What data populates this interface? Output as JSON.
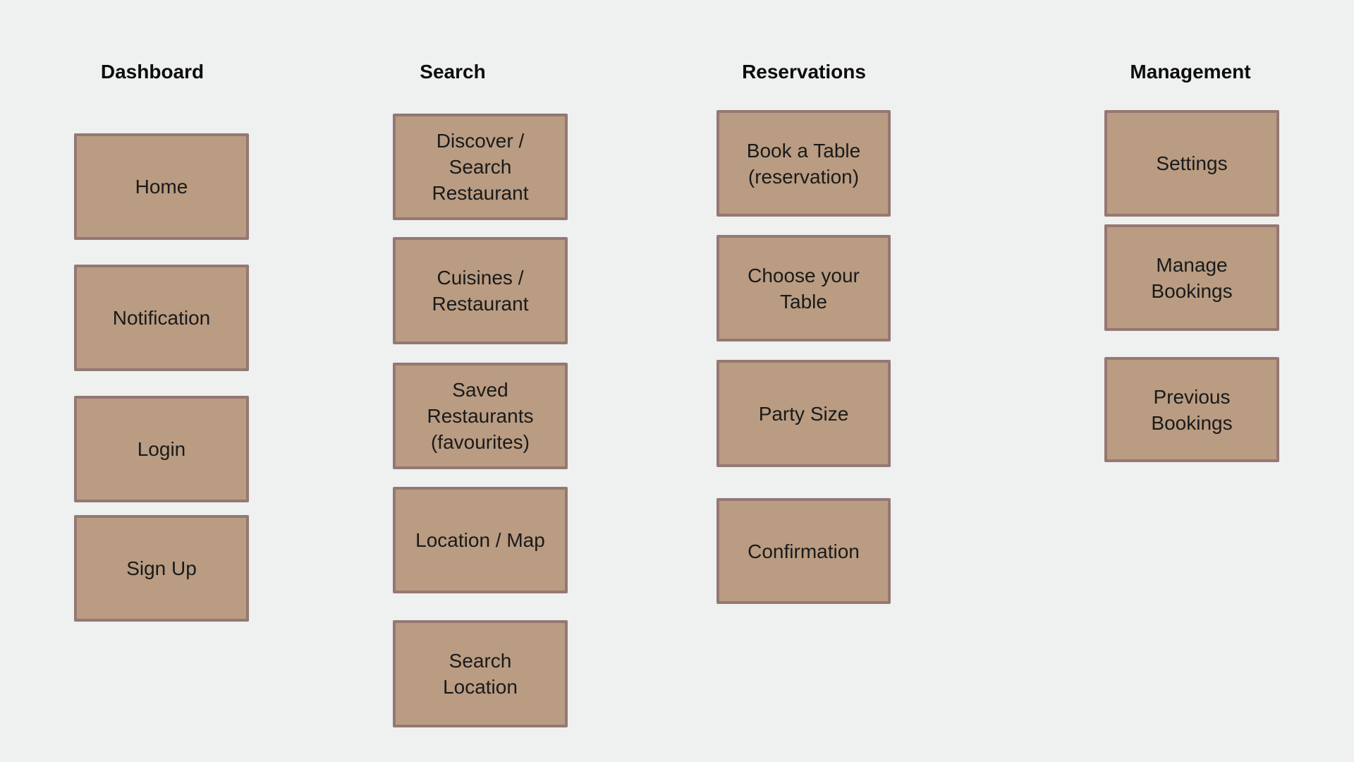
{
  "diagram": {
    "columns": [
      {
        "title": "Dashboard",
        "items": [
          "Home",
          "Notification",
          "Login",
          "Sign Up"
        ]
      },
      {
        "title": "Search",
        "items": [
          "Discover /\nSearch\nRestaurant",
          "Cuisines /\nRestaurant",
          "Saved\nRestaurants\n(favourites)",
          "Location / Map",
          "Search\nLocation"
        ]
      },
      {
        "title": "Reservations",
        "items": [
          "Book a Table\n(reservation)",
          "Choose your\nTable",
          "Party Size",
          "Confirmation"
        ]
      },
      {
        "title": "Management",
        "items": [
          "Settings",
          "Manage\nBookings",
          "Previous\nBookings"
        ]
      }
    ]
  },
  "colors": {
    "background": "#eff0f0",
    "card_fill": "#b99c82",
    "card_border": "#957873",
    "text": "#1a1a1a"
  }
}
